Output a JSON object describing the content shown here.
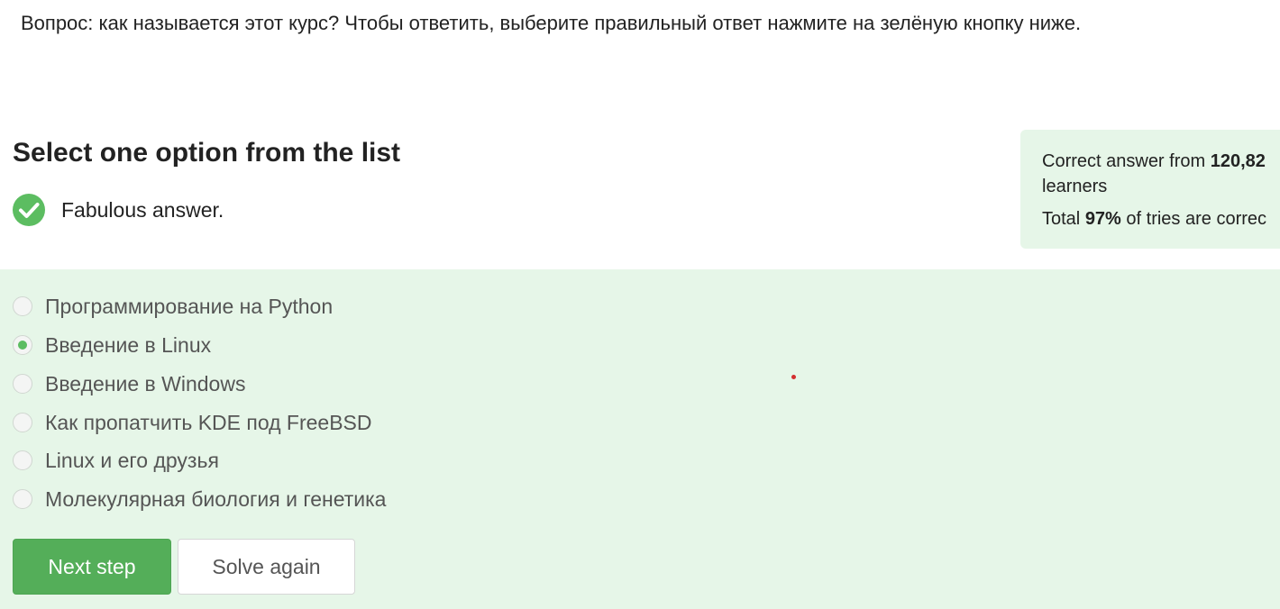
{
  "question": {
    "text": "Вопрос: как называется этот курс? Чтобы ответить, выберите правильный ответ нажмите на зелёную кнопку ниже."
  },
  "quiz": {
    "heading": "Select one option from the list",
    "feedback": {
      "icon": "check-circle-icon",
      "text": "Fabulous answer."
    }
  },
  "stats": {
    "line1_prefix": "Correct answer from ",
    "learners_count": "120,82",
    "line2": "learners",
    "total_prefix": "Total ",
    "percent": "97%",
    "total_suffix": " of tries are correc"
  },
  "options": [
    {
      "label": "Программирование на Python",
      "selected": false
    },
    {
      "label": "Введение в Linux",
      "selected": true
    },
    {
      "label": "Введение в Windows",
      "selected": false
    },
    {
      "label": "Как пропатчить KDE под FreeBSD",
      "selected": false
    },
    {
      "label": "Linux и его друзья",
      "selected": false
    },
    {
      "label": "Молекулярная биология и генетика",
      "selected": false
    }
  ],
  "buttons": {
    "next_label": "Next step",
    "again_label": "Solve again"
  },
  "colors": {
    "accent_green": "#54ae59",
    "answer_area_bg": "#e6f6e8",
    "check_green": "#5cbd61",
    "cursor_dot": "#d32f2f"
  }
}
